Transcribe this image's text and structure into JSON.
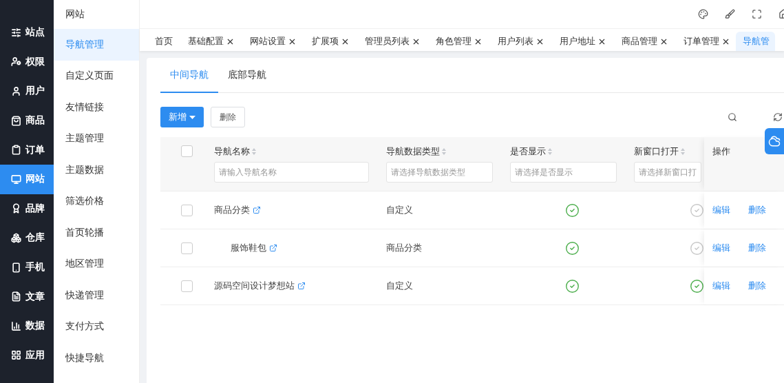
{
  "nav": {
    "items": [
      {
        "label": "站点",
        "selected": false
      },
      {
        "label": "权限",
        "selected": false
      },
      {
        "label": "用户",
        "selected": false
      },
      {
        "label": "商品",
        "selected": false
      },
      {
        "label": "订单",
        "selected": false
      },
      {
        "label": "网站",
        "selected": true
      },
      {
        "label": "品牌",
        "selected": false
      },
      {
        "label": "仓库",
        "selected": false
      },
      {
        "label": "手机",
        "selected": false
      },
      {
        "label": "文章",
        "selected": false
      },
      {
        "label": "数据",
        "selected": false
      },
      {
        "label": "应用",
        "selected": false
      }
    ]
  },
  "submenu": {
    "title": "网站",
    "items": [
      {
        "label": "导航管理",
        "selected": true
      },
      {
        "label": "自定义页面",
        "selected": false
      },
      {
        "label": "友情链接",
        "selected": false
      },
      {
        "label": "主题管理",
        "selected": false
      },
      {
        "label": "主题数据",
        "selected": false
      },
      {
        "label": "筛选价格",
        "selected": false
      },
      {
        "label": "首页轮播",
        "selected": false
      },
      {
        "label": "地区管理",
        "selected": false
      },
      {
        "label": "快递管理",
        "selected": false
      },
      {
        "label": "支付方式",
        "selected": false
      },
      {
        "label": "快捷导航",
        "selected": false
      }
    ]
  },
  "page_tabs": [
    {
      "label": "首页",
      "closable": false,
      "selected": false
    },
    {
      "label": "基础配置",
      "closable": true,
      "selected": false
    },
    {
      "label": "网站设置",
      "closable": true,
      "selected": false
    },
    {
      "label": "扩展项",
      "closable": true,
      "selected": false
    },
    {
      "label": "管理员列表",
      "closable": true,
      "selected": false
    },
    {
      "label": "角色管理",
      "closable": true,
      "selected": false
    },
    {
      "label": "用户列表",
      "closable": true,
      "selected": false
    },
    {
      "label": "用户地址",
      "closable": true,
      "selected": false
    },
    {
      "label": "商品管理",
      "closable": true,
      "selected": false
    },
    {
      "label": "订单管理",
      "closable": true,
      "selected": false
    },
    {
      "label": "导航管",
      "closable": false,
      "selected": true
    }
  ],
  "content_tabs": [
    {
      "label": "中间导航",
      "selected": true
    },
    {
      "label": "底部导航",
      "selected": false
    }
  ],
  "toolbar": {
    "add_button": "新增",
    "delete_button": "删除"
  },
  "table": {
    "columns": [
      {
        "label": "导航名称",
        "placeholder": "请输入导航名称"
      },
      {
        "label": "导航数据类型",
        "placeholder": "请选择导航数据类型"
      },
      {
        "label": "是否显示",
        "placeholder": "请选择是否显示"
      },
      {
        "label": "新窗口打开",
        "placeholder": "请选择新窗口打"
      },
      {
        "label": "操作"
      }
    ],
    "header_checked": false,
    "rows": [
      {
        "name": "商品分类",
        "type": "自定义",
        "shown": true,
        "new_window": false,
        "checked": false,
        "actions": [
          "编辑",
          "删除"
        ],
        "children": [
          {
            "name": "服饰鞋包",
            "type": "商品分类",
            "shown": true,
            "new_window": false,
            "checked": false,
            "actions": [
              "编辑",
              "删除"
            ]
          }
        ]
      },
      {
        "name": "源码空间设计梦想站",
        "type": "自定义",
        "shown": true,
        "new_window": true,
        "checked": false,
        "actions": [
          "编辑",
          "删除"
        ]
      }
    ]
  }
}
